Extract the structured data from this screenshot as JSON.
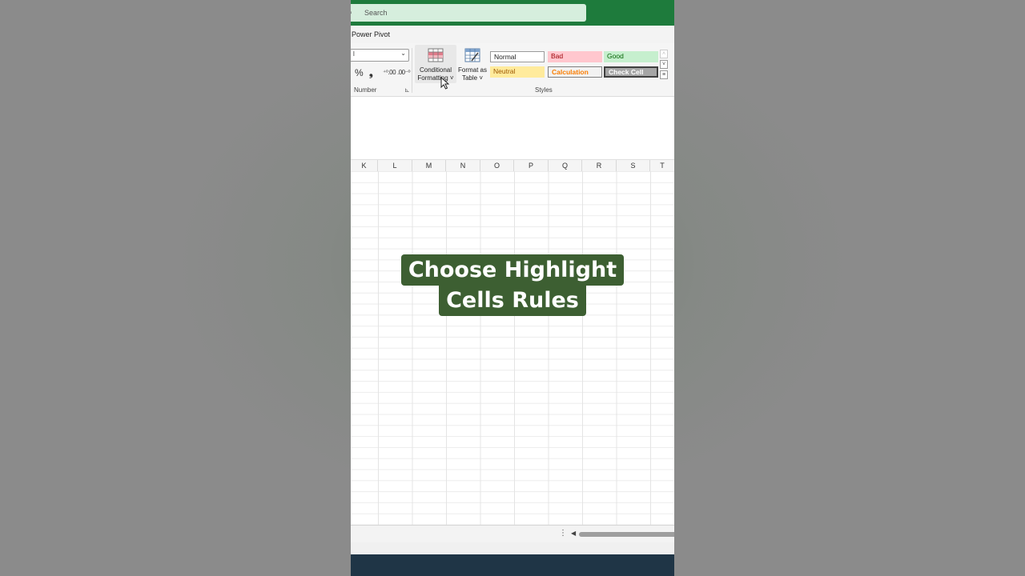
{
  "search": {
    "placeholder": "Search"
  },
  "ribbon": {
    "tab_label": "Power Pivot",
    "number_group": {
      "format_value": "l",
      "percent": "%",
      "comma": "❟",
      "increase_decimal": "⁺⁰.00",
      "decrease_decimal": ".00⁻⁰",
      "label": "Number"
    },
    "conditional_formatting": {
      "line1": "Conditional",
      "line2": "Formatting ˅"
    },
    "format_as_table": {
      "line1": "Format as",
      "line2": "Table ˅"
    },
    "styles": {
      "label": "Styles",
      "cells": [
        "Normal",
        "Bad",
        "Good",
        "Neutral",
        "Calculation",
        "Check Cell"
      ]
    }
  },
  "columns": [
    "K",
    "L",
    "M",
    "N",
    "O",
    "P",
    "Q",
    "R",
    "S",
    "T"
  ],
  "caption": {
    "line1": "Choose Highlight",
    "line2": "Cells Rules"
  },
  "colors": {
    "title_bar": "#1e7b3c",
    "caption_bg": "#3d5f32",
    "taskbar": "#1f3546"
  }
}
